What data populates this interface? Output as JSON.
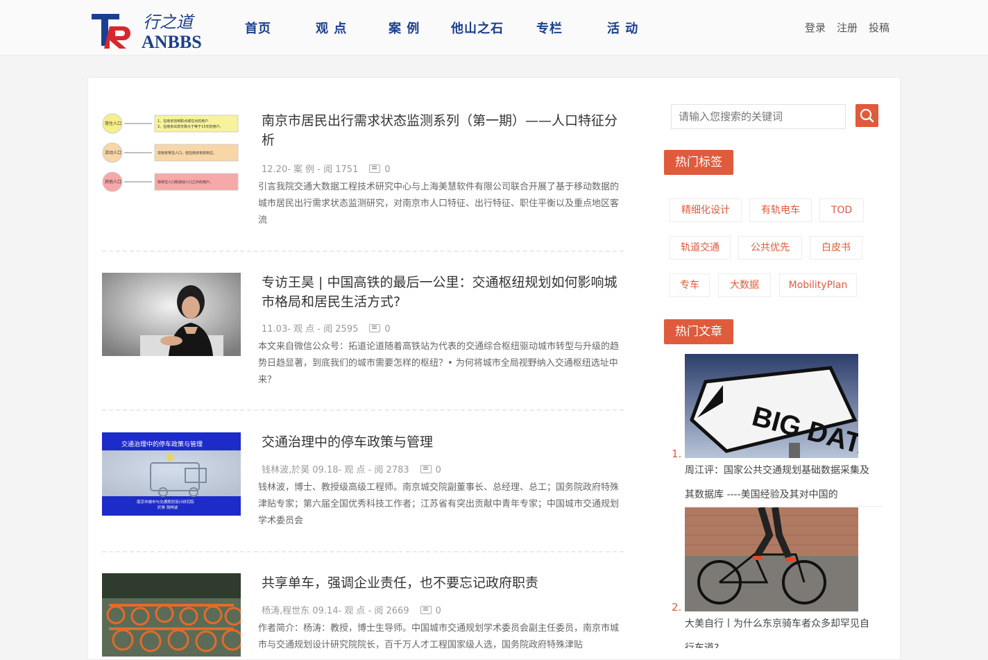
{
  "site": {
    "logo_text_top": "行之道",
    "logo_text_bottom": "ANBBS",
    "logo_letters": "TR"
  },
  "nav": [
    {
      "label": "首页"
    },
    {
      "label": "观 点"
    },
    {
      "label": "案 例"
    },
    {
      "label": "他山之石"
    },
    {
      "label": "专栏"
    },
    {
      "label": "活 动"
    }
  ],
  "user_links": {
    "login": "登录",
    "register": "注册",
    "submit": "投稿"
  },
  "articles": [
    {
      "title": "南京市居民出行需求状态监测系列（第一期）——人口特征分析",
      "meta": "12.20- 案 例 - 阅 1751",
      "comments": "0",
      "excerpt": "引言我院交通大数据工程技术研究中心与上海美慧软件有限公司联合开展了基于移动数据的城市居民出行需求状态监测研究，对南京市人口特征、出行特征、职住平衡以及重点地区客流",
      "thumb_labels": [
        "常住人口",
        "流动人口",
        "其他人口"
      ],
      "thumb_texts": [
        "1、在南京找到职点或住点的用户\n2、在南京出现天数大于等于15天的用户。",
        "非南京常住人口，但在南京有收到过。",
        "除常住人口和流动人口之外的用户。"
      ]
    },
    {
      "title": "专访王昊 | 中国高铁的最后一公里：交通枢纽规划如何影响城市格局和居民生活方式?",
      "meta": "11.03- 观 点 - 阅 2595",
      "comments": "0",
      "excerpt": "本文来自微信公众号：拓道论道随着高铁站为代表的交通综合枢纽驱动城市转型与升级的趋势日趋显著，到底我们的城市需要怎样的枢纽？• 为何将城市全局视野纳入交通枢纽选址中来？"
    },
    {
      "title": "交通治理中的停车政策与管理",
      "meta": "钱林波,於昊 09.18- 观 点 - 阅 2783",
      "comments": "0",
      "excerpt": "钱林波，博士、教授级高级工程师。南京城交院副董事长、总经理、总工；国务院政府特殊津贴专家；第六届全国优秀科技工作者；江苏省有突出贡献中青年专家；中国城市交通规划学术委员会",
      "thumb_title": "交通治理中的停车政策与管理",
      "thumb_org": "南京市城市与交通规划设计研究院",
      "thumb_authors": "於昊    钱林波"
    },
    {
      "title": "共享单车，强调企业责任，也不要忘记政府职责",
      "meta": "杨涛,程世东 09.14- 观 点 - 阅 2669",
      "comments": "0",
      "excerpt": "作者简介：杨涛：教授，博士生导师。中国城市交通规划学术委员会副主任委员，南京市城市与交通规划设计研究院院长，百千万人才工程国家级人选，国务院政府特殊津贴"
    }
  ],
  "search": {
    "placeholder": "请输入您搜索的关键词"
  },
  "hot_tags": {
    "title": "热门标签",
    "tags": [
      "精细化设计",
      "有轨电车",
      "TOD",
      "轨道交通",
      "公共优先",
      "白皮书",
      "专车",
      "大数据",
      "MobilityPlan"
    ]
  },
  "hot_articles": {
    "title": "热门文章",
    "items": [
      {
        "rank": "1.",
        "title_line1": "周江评：国家公共交通规划基础数据采集及",
        "title_line2": "其数据库 ----美国经验及其对中国的",
        "image_text": "BIG DATA"
      },
      {
        "rank": "2.",
        "title_line1": "大美自行丨为什么东京骑车者众多却罕见自",
        "title_line2": "行车道?"
      }
    ]
  },
  "colors": {
    "accent": "#e05a3c",
    "nav": "#1a3f8f",
    "logo_blue": "#1a3f8f",
    "logo_red": "#d9262c"
  }
}
